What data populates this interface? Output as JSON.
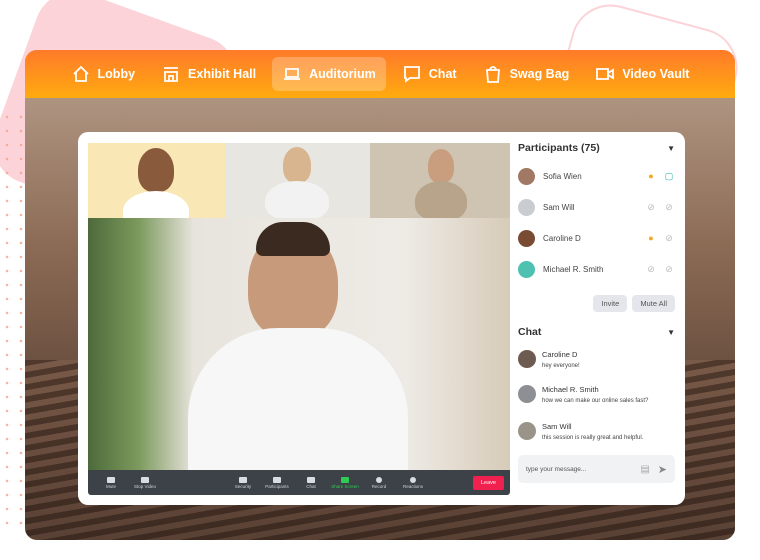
{
  "nav": {
    "items": [
      {
        "label": "Lobby",
        "icon": "home-icon"
      },
      {
        "label": "Exhibit Hall",
        "icon": "store-icon"
      },
      {
        "label": "Auditorium",
        "icon": "laptop-icon",
        "active": true
      },
      {
        "label": "Chat",
        "icon": "chat-bubble-icon"
      },
      {
        "label": "Swag Bag",
        "icon": "bag-icon"
      },
      {
        "label": "Video Vault",
        "icon": "video-camera-icon"
      }
    ]
  },
  "toolbar": {
    "mute": "Mute",
    "stop_video": "Stop Video",
    "security": "Security",
    "participants": "Participants",
    "chat": "Chat",
    "share_screen": "Share Screen",
    "record": "Record",
    "reactions": "Reactions",
    "leave": "Leave"
  },
  "participants": {
    "title": "Participants (75)",
    "list": [
      {
        "name": "Sofia Wien",
        "mic": "on",
        "camera": "on"
      },
      {
        "name": "Sam Will",
        "mic": "off",
        "camera": "off"
      },
      {
        "name": "Caroline D",
        "mic": "on",
        "camera": "off"
      },
      {
        "name": "Michael R. Smith",
        "mic": "off",
        "camera": "off"
      }
    ],
    "invite": "Invite",
    "mute_all": "Mute All"
  },
  "chat": {
    "title": "Chat",
    "messages": [
      {
        "name": "Caroline D",
        "text": "hey everyone!"
      },
      {
        "name": "Michael R. Smith",
        "text": "how we can make our online sales fast?"
      },
      {
        "name": "Sam Will",
        "text": "this session is really great and helpful."
      }
    ],
    "placeholder": "type your message..."
  },
  "colors": {
    "accent": "#ff7a2a",
    "mic_on": "#f5a623",
    "camera_on": "#2bb3a8",
    "leave": "#f0214f",
    "share": "#2ecc52"
  }
}
